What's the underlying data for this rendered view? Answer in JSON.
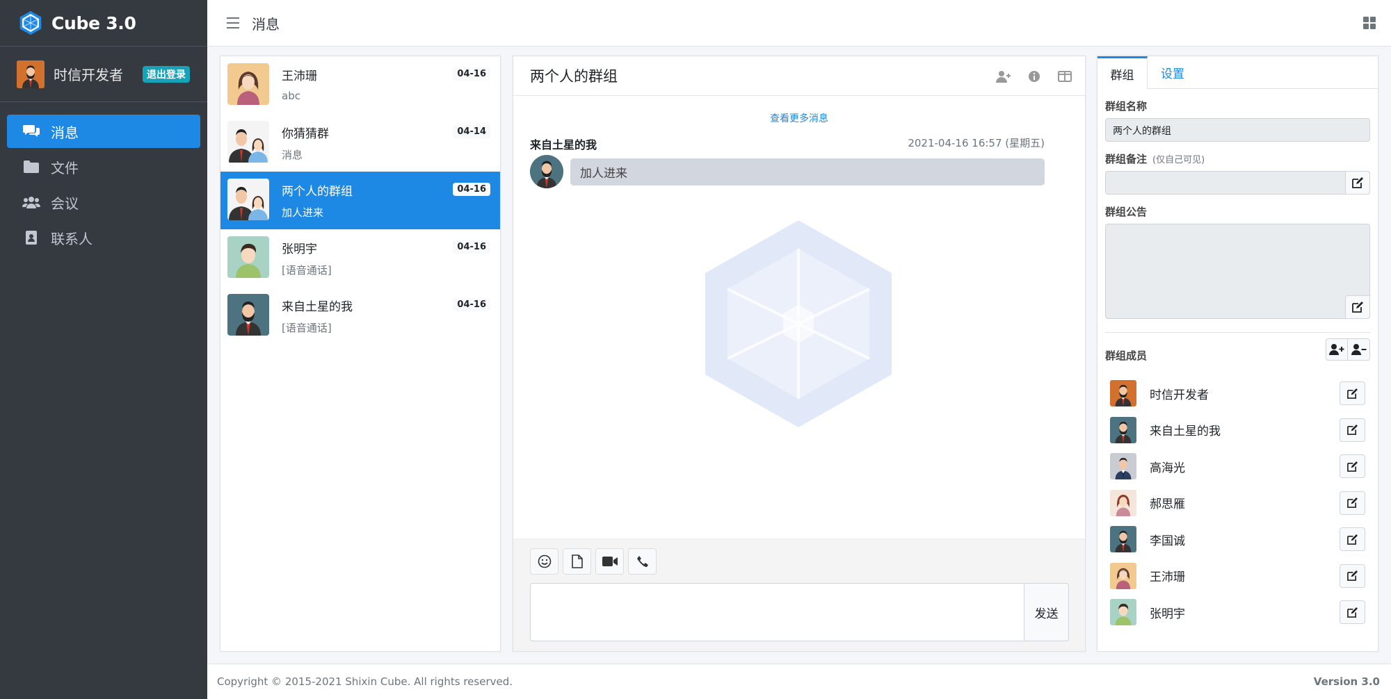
{
  "app": {
    "title": "Cube 3.0"
  },
  "user": {
    "name": "时信开发者",
    "logout_label": "退出登录"
  },
  "nav": {
    "items": [
      {
        "label": "消息",
        "icon": "comments-icon",
        "active": true
      },
      {
        "label": "文件",
        "icon": "folder-icon",
        "active": false
      },
      {
        "label": "会议",
        "icon": "users-icon",
        "active": false
      },
      {
        "label": "联系人",
        "icon": "address-book-icon",
        "active": false
      }
    ]
  },
  "header": {
    "title": "消息"
  },
  "conversations": [
    {
      "name": "王沛珊",
      "snippet": "abc",
      "date": "04-16",
      "avatar": "female",
      "active": false
    },
    {
      "name": "你猜猜群",
      "snippet": "消息",
      "date": "04-14",
      "avatar": "group",
      "active": false
    },
    {
      "name": "两个人的群组",
      "snippet": "加人进来",
      "date": "04-16",
      "avatar": "group",
      "active": true
    },
    {
      "name": "张明宇",
      "snippet": "[语音通话]",
      "date": "04-16",
      "avatar": "male-green",
      "active": false
    },
    {
      "name": "来自土星的我",
      "snippet": "[语音通话]",
      "date": "04-16",
      "avatar": "male-beard",
      "active": false
    }
  ],
  "chat": {
    "title": "两个人的群组",
    "more_messages": "查看更多消息",
    "messages": [
      {
        "sender": "来自土星的我",
        "time": "2021-04-16 16:57 (星期五)",
        "text": "加人进来"
      }
    ],
    "send_label": "发送",
    "tools": [
      "emoji-icon",
      "file-icon",
      "video-icon",
      "phone-icon"
    ]
  },
  "info": {
    "tabs": [
      {
        "label": "群组",
        "active": true
      },
      {
        "label": "设置",
        "active": false
      }
    ],
    "group_name_label": "群组名称",
    "group_name": "两个人的群组",
    "remark_label": "群组备注",
    "remark_hint": "(仅自己可见)",
    "notice_label": "群组公告",
    "members_label": "群组成员",
    "members": [
      {
        "name": "时信开发者",
        "avatar": "male-orange"
      },
      {
        "name": "来自土星的我",
        "avatar": "male-beard"
      },
      {
        "name": "高海光",
        "avatar": "male-suit"
      },
      {
        "name": "郝思雁",
        "avatar": "female-red"
      },
      {
        "name": "李国诚",
        "avatar": "male-beard"
      },
      {
        "name": "王沛珊",
        "avatar": "female"
      },
      {
        "name": "张明宇",
        "avatar": "male-green"
      }
    ]
  },
  "footer": {
    "copyright": "Copyright © 2015-2021 Shixin Cube. All rights reserved.",
    "version": "Version 3.0"
  },
  "colors": {
    "sidebar": "#343a40",
    "accent": "#1e88e5",
    "badge": "#17a2b8"
  }
}
